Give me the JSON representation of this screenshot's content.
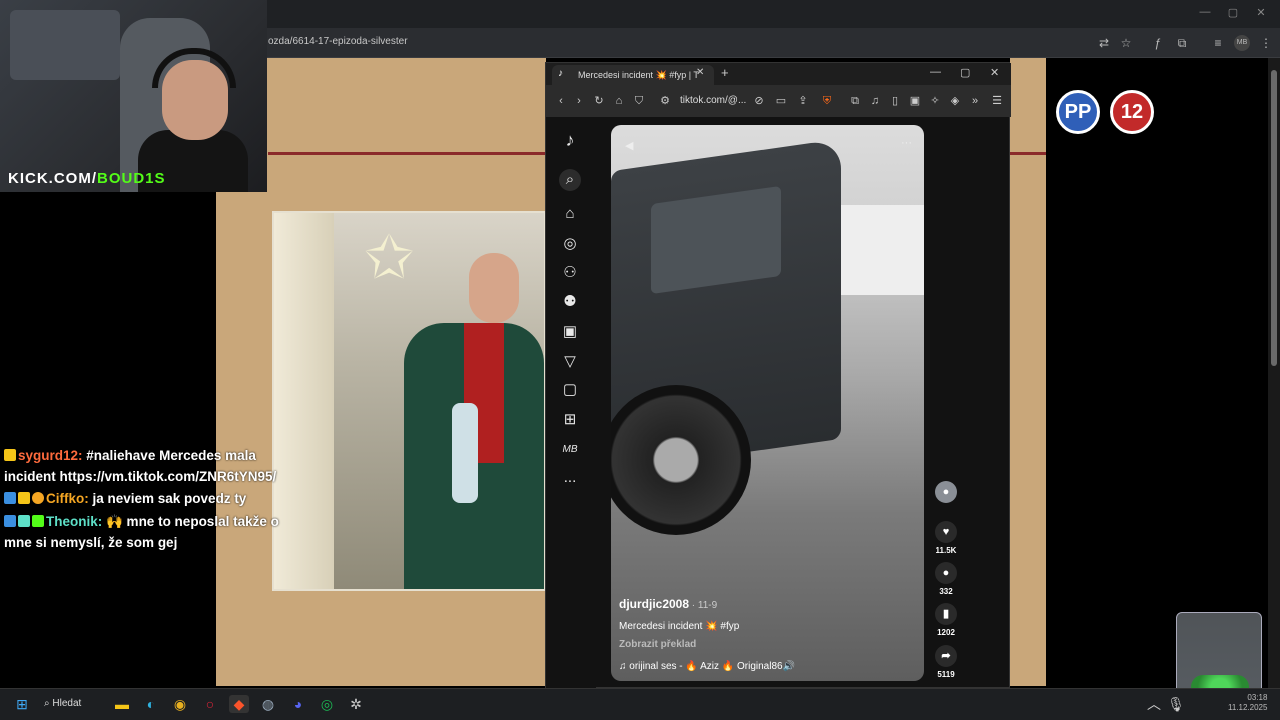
{
  "browser": {
    "url": "ozda/6614-17-epizoda-silvester",
    "window_controls": [
      "—",
      "▢",
      "✕"
    ]
  },
  "webcam": {
    "watermark_prefix": "KICK.COM/",
    "watermark_user": "BOUD1S"
  },
  "chat": [
    {
      "user": "sygurd12:",
      "user_color": "#ff6b3d",
      "message": " #naliehave Mercedes mala incident https://vm.tiktok.com/ZNR6tYN95/"
    },
    {
      "user": "Ciffko:",
      "user_color": "#f5a623",
      "message": " ja neviem sak povedz ty"
    },
    {
      "user": "Theonik:",
      "user_color": "#5ee0c8",
      "message": " 🙌 mne to neposlal takže o mne si nemyslí, že som gej"
    }
  ],
  "channel_logos": [
    {
      "label": "PP",
      "color": "#2f5fb8"
    },
    {
      "label": "12",
      "color": "#c22a2a"
    }
  ],
  "tiktok_window": {
    "tab_title": "Mercedesi incident 💥 #fyp | T",
    "url": "tiktok.com/@...",
    "sidebar_profile": "MB",
    "sidebar_more": "...",
    "video": {
      "username": "djurdjic2008",
      "date": " · 11-9",
      "description": "Mercedesi incident 💥 #fyp",
      "translate": "Zobrazit překlad",
      "music": "♫  orijinal ses - 🔥 Aziz 🔥 Original86🔊"
    },
    "actions": {
      "likes": "11.5K",
      "comments": "332",
      "saves": "1202",
      "shares": "5119"
    }
  },
  "taskbar": {
    "search_label": "Hledat",
    "clock_time": "03:18",
    "clock_date": "11.12.2025"
  }
}
